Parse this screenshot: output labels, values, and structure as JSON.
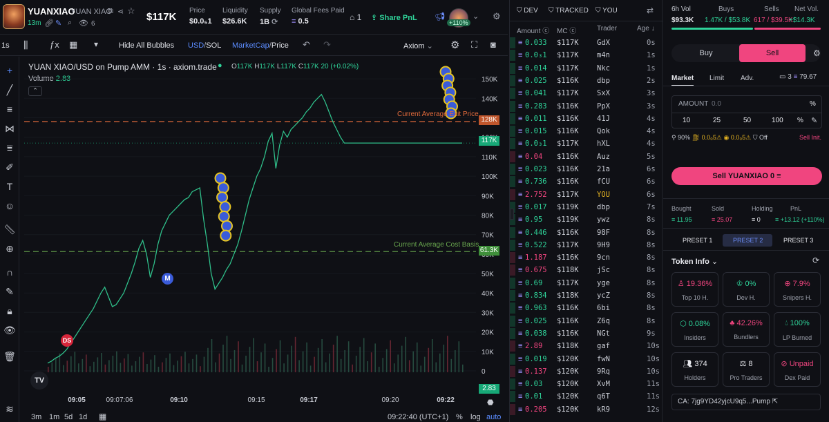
{
  "header": {
    "token_name": "YUANXIAO",
    "token_full": "YUAN XIAO",
    "age": "13m",
    "viewers": "6",
    "market_cap": "$117K",
    "stats": [
      {
        "label": "Price",
        "value": "$0.0₅1"
      },
      {
        "label": "Liquidity",
        "value": "$26.6K"
      },
      {
        "label": "Supply",
        "value": "1B"
      },
      {
        "label": "Global Fees Paid",
        "value": "0.5"
      }
    ],
    "watch_count": "1",
    "share_pnl": "Share PnL",
    "pnl_badge": "+110%"
  },
  "toolbar": {
    "interval": "1s",
    "hide_bubbles": "Hide All Bubbles",
    "usd": "USD",
    "sol": "SOL",
    "marketcap": "MarketCap",
    "price": "Price",
    "source": "Axiom"
  },
  "chart_title": "YUAN XIAO/USD on Pump AMM · 1s · axiom.trade",
  "ohlc": {
    "o": "117K",
    "h": "117K",
    "l": "117K",
    "c": "117K",
    "change": "20 (+0.02%)"
  },
  "volume_label": "Volume",
  "volume_value": "2.83",
  "lines": {
    "avg_exit": "Current Average Exit Price",
    "avg_cost": "Current Average Cost Basis"
  },
  "price_tags": {
    "exit": "128K",
    "last": "117K",
    "cost": "61.3K",
    "vol": "2.83"
  },
  "bottom": {
    "ranges": [
      "3m",
      "1m",
      "5d",
      "1d"
    ],
    "time": "09:22:40 (UTC+1)",
    "pct": "%",
    "log": "log",
    "auto": "auto"
  },
  "trades": {
    "tabs": [
      "DEV",
      "TRACKED",
      "YOU"
    ],
    "columns": [
      "Amount",
      "MC",
      "Trader",
      "Age"
    ],
    "rows": [
      {
        "amt": "0.033",
        "mc": "$117K",
        "trader": "GdX",
        "age": "0s",
        "side": "buy"
      },
      {
        "amt": "0.0₃1",
        "mc": "$117K",
        "trader": "m4n",
        "age": "1s",
        "side": "buy"
      },
      {
        "amt": "0.014",
        "mc": "$117K",
        "trader": "Nkc",
        "age": "1s",
        "side": "buy"
      },
      {
        "amt": "0.025",
        "mc": "$116K",
        "trader": "dbp",
        "age": "2s",
        "side": "buy"
      },
      {
        "amt": "0.041",
        "mc": "$117K",
        "trader": "SxX",
        "age": "3s",
        "side": "buy"
      },
      {
        "amt": "0.283",
        "mc": "$116K",
        "trader": "PpX",
        "age": "3s",
        "side": "buy"
      },
      {
        "amt": "0.011",
        "mc": "$116K",
        "trader": "41J",
        "age": "4s",
        "side": "buy"
      },
      {
        "amt": "0.015",
        "mc": "$116K",
        "trader": "Qok",
        "age": "4s",
        "side": "buy"
      },
      {
        "amt": "0.0₃1",
        "mc": "$117K",
        "trader": "hXL",
        "age": "4s",
        "side": "buy"
      },
      {
        "amt": "0.04",
        "mc": "$116K",
        "trader": "Auz",
        "age": "5s",
        "side": "sell"
      },
      {
        "amt": "0.023",
        "mc": "$116K",
        "trader": "21a",
        "age": "6s",
        "side": "buy"
      },
      {
        "amt": "0.736",
        "mc": "$116K",
        "trader": "fCU",
        "age": "6s",
        "side": "buy"
      },
      {
        "amt": "2.752",
        "mc": "$117K",
        "trader": "YOU",
        "age": "6s",
        "side": "sell"
      },
      {
        "amt": "0.017",
        "mc": "$119K",
        "trader": "dbp",
        "age": "7s",
        "side": "buy"
      },
      {
        "amt": "0.95",
        "mc": "$119K",
        "trader": "ywz",
        "age": "8s",
        "side": "buy"
      },
      {
        "amt": "0.446",
        "mc": "$116K",
        "trader": "98F",
        "age": "8s",
        "side": "buy"
      },
      {
        "amt": "0.522",
        "mc": "$117K",
        "trader": "9H9",
        "age": "8s",
        "side": "buy"
      },
      {
        "amt": "1.187",
        "mc": "$116K",
        "trader": "9cn",
        "age": "8s",
        "side": "sell"
      },
      {
        "amt": "0.675",
        "mc": "$118K",
        "trader": "jSc",
        "age": "8s",
        "side": "sell"
      },
      {
        "amt": "0.69",
        "mc": "$117K",
        "trader": "yge",
        "age": "8s",
        "side": "buy"
      },
      {
        "amt": "0.834",
        "mc": "$118K",
        "trader": "ycZ",
        "age": "8s",
        "side": "buy"
      },
      {
        "amt": "0.963",
        "mc": "$116K",
        "trader": "6bi",
        "age": "8s",
        "side": "buy"
      },
      {
        "amt": "0.025",
        "mc": "$116K",
        "trader": "Z6q",
        "age": "8s",
        "side": "buy"
      },
      {
        "amt": "0.038",
        "mc": "$116K",
        "trader": "NGt",
        "age": "9s",
        "side": "buy"
      },
      {
        "amt": "2.89",
        "mc": "$118K",
        "trader": "gaf",
        "age": "10s",
        "side": "sell"
      },
      {
        "amt": "0.019",
        "mc": "$120K",
        "trader": "fwN",
        "age": "10s",
        "side": "buy"
      },
      {
        "amt": "0.137",
        "mc": "$120K",
        "trader": "9Rq",
        "age": "10s",
        "side": "sell"
      },
      {
        "amt": "0.03",
        "mc": "$120K",
        "trader": "XvM",
        "age": "11s",
        "side": "buy"
      },
      {
        "amt": "0.01",
        "mc": "$120K",
        "trader": "q6T",
        "age": "11s",
        "side": "buy"
      },
      {
        "amt": "0.205",
        "mc": "$120K",
        "trader": "kR9",
        "age": "12s",
        "side": "sell"
      }
    ]
  },
  "right": {
    "vol_label": "6h Vol",
    "vol": "$93.3K",
    "buys_label": "Buys",
    "buys": "1.47K / $53.8K",
    "sells_label": "Sells",
    "sells": "617 / $39.5K",
    "net_label": "Net Vol.",
    "net": "+$14.3K",
    "buy_tab": "Buy",
    "sell_tab": "Sell",
    "order_tabs": [
      "Market",
      "Limit",
      "Adv."
    ],
    "wallets": "3",
    "balance": "79.67",
    "amount_label": "AMOUNT",
    "amount_value": "0.0",
    "amount_unit": "%",
    "presets": [
      "10",
      "25",
      "50",
      "100"
    ],
    "slippage": "90%",
    "fee1": "0.0₀5",
    "fee2": "0.0₀5",
    "mev": "Off",
    "sell_init": "Sell Init.",
    "sell_button": "Sell YUANXIAO 0",
    "pos": [
      {
        "label": "Bought",
        "value": "11.95"
      },
      {
        "label": "Sold",
        "value": "25.07"
      },
      {
        "label": "Holding",
        "value": "0"
      },
      {
        "label": "PnL",
        "value": "+13.12 (+110%)"
      }
    ],
    "preset_tabs": [
      "PRESET 1",
      "PRESET 2",
      "PRESET 3"
    ],
    "token_info": "Token Info",
    "cards": [
      {
        "value": "19.36%",
        "label": "Top 10 H.",
        "color": "#f0457f"
      },
      {
        "value": "0%",
        "label": "Dev H.",
        "color": "#2fd49a"
      },
      {
        "value": "7.9%",
        "label": "Snipers H.",
        "color": "#f0457f"
      },
      {
        "value": "0.08%",
        "label": "Insiders",
        "color": "#2fd49a"
      },
      {
        "value": "42.26%",
        "label": "Bundlers",
        "color": "#f0457f"
      },
      {
        "value": "100%",
        "label": "LP Burned",
        "color": "#2fd49a"
      },
      {
        "value": "374",
        "label": "Holders",
        "color": "#e8e9ee"
      },
      {
        "value": "8",
        "label": "Pro Traders",
        "color": "#e8e9ee"
      },
      {
        "value": "Unpaid",
        "label": "Dex Paid",
        "color": "#f0457f"
      }
    ],
    "ca": "CA: 7jg9YD42yjcU9q5...Pump"
  },
  "chart_data": {
    "type": "line",
    "title": "YUAN XIAO/USD on Pump AMM · 1s · axiom.trade",
    "x_ticks": [
      "09:05",
      "09:07:06",
      "09:10",
      "09:15",
      "09:17",
      "09:20",
      "09:22"
    ],
    "y_ticks": [
      "150K",
      "140K",
      "130K",
      "120K",
      "110K",
      "100K",
      "90K",
      "80K",
      "70K",
      "60K",
      "50K",
      "40K",
      "30K",
      "20K",
      "10K",
      "0"
    ],
    "ylim": [
      0,
      155000
    ],
    "series": [
      {
        "x": [
          0,
          8,
          16,
          22,
          28,
          34,
          40,
          46,
          52,
          58,
          64,
          68,
          72,
          76,
          80,
          84,
          88,
          92,
          96,
          100,
          104,
          108,
          112,
          116,
          120,
          124,
          128,
          132,
          136,
          140,
          144,
          148,
          152,
          156,
          160,
          164,
          168,
          172,
          176,
          180,
          184,
          188,
          192,
          196,
          200,
          204,
          208,
          212,
          216,
          220,
          224,
          228,
          232,
          236,
          240,
          244,
          248,
          252,
          256,
          260,
          264,
          268,
          272,
          276,
          280,
          284,
          288,
          292,
          296,
          300,
          304,
          308,
          312,
          316,
          320,
          324,
          328,
          332,
          336,
          340,
          344,
          348,
          352,
          356,
          360,
          364,
          368,
          372,
          376,
          380,
          384,
          388,
          392,
          396,
          400,
          404,
          408,
          412,
          416,
          420,
          424,
          428,
          432,
          436,
          440,
          444,
          448,
          452,
          456,
          460
        ],
        "y": [
          4000,
          5000,
          6500,
          7500,
          9000,
          11000,
          14000,
          17000,
          20000,
          23000,
          26000,
          29000,
          32000,
          36000,
          40000,
          43000,
          38000,
          33000,
          34000,
          37000,
          40000,
          45000,
          50000,
          56000,
          63000,
          67000,
          60000,
          48000,
          55000,
          65000,
          72000,
          76000,
          80000,
          82000,
          84000,
          86000,
          88000,
          89000,
          92000,
          93000,
          94000,
          78000,
          65000,
          50000,
          42000,
          45000,
          48000,
          52000,
          55000,
          60000,
          65000,
          72000,
          80000,
          88000,
          94000,
          100000,
          104000,
          110000,
          118000,
          122000,
          104000,
          116000,
          123000,
          120000,
          124000,
          126000,
          128000,
          130000,
          133000,
          135000,
          138000,
          140000,
          142000,
          138000,
          133000,
          128000,
          124000,
          120000,
          117000,
          117000,
          117000,
          117000,
          117000,
          117000,
          117000,
          117000,
          117000,
          117000,
          117000,
          117000,
          117000,
          117000,
          117000,
          117000,
          117000,
          117000,
          117000,
          117000,
          117000,
          117000,
          117000,
          117000,
          117000,
          117000,
          117000,
          117000,
          117000,
          117000,
          117000,
          117000
        ]
      }
    ],
    "hlines": [
      {
        "label": "Current Average Exit Price",
        "value": 128000,
        "color": "#e36b3c"
      },
      {
        "label": "Current Average Cost Basis",
        "value": 61300,
        "color": "#6aa84f"
      }
    ]
  }
}
